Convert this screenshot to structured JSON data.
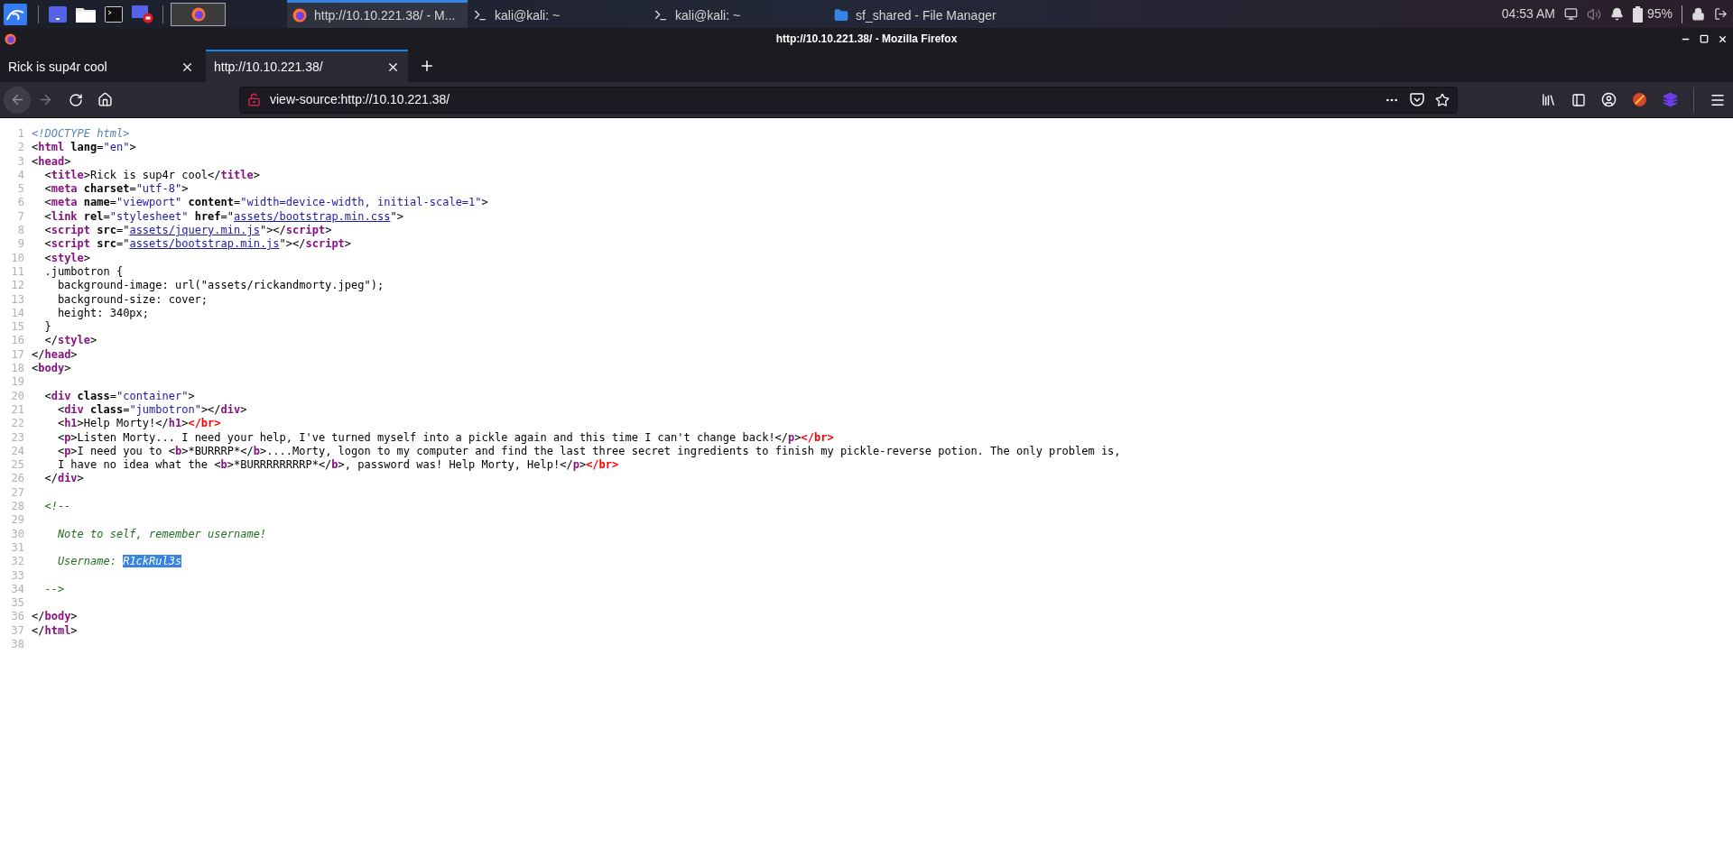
{
  "taskbar": {
    "windows": [
      {
        "kind": "browser",
        "title": "http://10.10.221.38/ - M...",
        "selected": true
      },
      {
        "kind": "terminal",
        "title": "kali@kali: ~",
        "selected": false
      },
      {
        "kind": "terminal",
        "title": "kali@kali: ~",
        "selected": false
      },
      {
        "kind": "folder",
        "title": "sf_shared - File Manager",
        "selected": false
      }
    ],
    "clock": "04:53 AM",
    "battery": "95%"
  },
  "window": {
    "title": "http://10.10.221.38/ - Mozilla Firefox"
  },
  "tabs": [
    {
      "label": "Rick is sup4r cool",
      "selected": false
    },
    {
      "label": "http://10.10.221.38/",
      "selected": true
    }
  ],
  "navigation": {
    "back_disabled": true,
    "forward_disabled": true
  },
  "address_bar": {
    "value": "view-source:http://10.10.221.38/"
  },
  "source": {
    "lines": [
      {
        "number": "1",
        "tokens": [
          {
            "kind": "doctype",
            "text": "<!DOCTYPE html>"
          }
        ]
      },
      {
        "number": "2",
        "tokens": [
          {
            "kind": "text",
            "text": "<"
          },
          {
            "kind": "tag",
            "text": "html"
          },
          {
            "kind": "attr",
            "text": " lang"
          },
          {
            "kind": "text",
            "text": "="
          },
          {
            "kind": "val",
            "text": "\"en\""
          },
          {
            "kind": "text",
            "text": ">"
          }
        ]
      },
      {
        "number": "3",
        "tokens": [
          {
            "kind": "text",
            "text": "<"
          },
          {
            "kind": "tag",
            "text": "head"
          },
          {
            "kind": "text",
            "text": ">"
          }
        ]
      },
      {
        "number": "4",
        "tokens": [
          {
            "kind": "text",
            "text": "  <"
          },
          {
            "kind": "tag",
            "text": "title"
          },
          {
            "kind": "text",
            "text": ">Rick is sup4r cool</"
          },
          {
            "kind": "tag",
            "text": "title"
          },
          {
            "kind": "text",
            "text": ">"
          }
        ]
      },
      {
        "number": "5",
        "tokens": [
          {
            "kind": "text",
            "text": "  <"
          },
          {
            "kind": "tag",
            "text": "meta"
          },
          {
            "kind": "attr",
            "text": " charset"
          },
          {
            "kind": "text",
            "text": "="
          },
          {
            "kind": "val",
            "text": "\"utf-8\""
          },
          {
            "kind": "text",
            "text": ">"
          }
        ]
      },
      {
        "number": "6",
        "tokens": [
          {
            "kind": "text",
            "text": "  <"
          },
          {
            "kind": "tag",
            "text": "meta"
          },
          {
            "kind": "attr",
            "text": " name"
          },
          {
            "kind": "text",
            "text": "="
          },
          {
            "kind": "val",
            "text": "\"viewport\""
          },
          {
            "kind": "attr",
            "text": " content"
          },
          {
            "kind": "text",
            "text": "="
          },
          {
            "kind": "val",
            "text": "\"width=device-width, initial-scale=1\""
          },
          {
            "kind": "text",
            "text": ">"
          }
        ]
      },
      {
        "number": "7",
        "tokens": [
          {
            "kind": "text",
            "text": "  <"
          },
          {
            "kind": "tag",
            "text": "link"
          },
          {
            "kind": "attr",
            "text": " rel"
          },
          {
            "kind": "text",
            "text": "="
          },
          {
            "kind": "val",
            "text": "\"stylesheet\""
          },
          {
            "kind": "attr",
            "text": " href"
          },
          {
            "kind": "text",
            "text": "=\""
          },
          {
            "kind": "link",
            "text": "assets/bootstrap.min.css"
          },
          {
            "kind": "text",
            "text": "\">"
          }
        ]
      },
      {
        "number": "8",
        "tokens": [
          {
            "kind": "text",
            "text": "  <"
          },
          {
            "kind": "tag",
            "text": "script"
          },
          {
            "kind": "attr",
            "text": " src"
          },
          {
            "kind": "text",
            "text": "=\""
          },
          {
            "kind": "link",
            "text": "assets/jquery.min.js"
          },
          {
            "kind": "text",
            "text": "\"></"
          },
          {
            "kind": "tag",
            "text": "script"
          },
          {
            "kind": "text",
            "text": ">"
          }
        ]
      },
      {
        "number": "9",
        "tokens": [
          {
            "kind": "text",
            "text": "  <"
          },
          {
            "kind": "tag",
            "text": "script"
          },
          {
            "kind": "attr",
            "text": " src"
          },
          {
            "kind": "text",
            "text": "=\""
          },
          {
            "kind": "link",
            "text": "assets/bootstrap.min.js"
          },
          {
            "kind": "text",
            "text": "\"></"
          },
          {
            "kind": "tag",
            "text": "script"
          },
          {
            "kind": "text",
            "text": ">"
          }
        ]
      },
      {
        "number": "10",
        "tokens": [
          {
            "kind": "text",
            "text": "  <"
          },
          {
            "kind": "tag",
            "text": "style"
          },
          {
            "kind": "text",
            "text": ">"
          }
        ]
      },
      {
        "number": "11",
        "tokens": [
          {
            "kind": "text",
            "text": "  .jumbotron {"
          }
        ]
      },
      {
        "number": "12",
        "tokens": [
          {
            "kind": "text",
            "text": "    background-image: url(\"assets/rickandmorty.jpeg\");"
          }
        ]
      },
      {
        "number": "13",
        "tokens": [
          {
            "kind": "text",
            "text": "    background-size: cover;"
          }
        ]
      },
      {
        "number": "14",
        "tokens": [
          {
            "kind": "text",
            "text": "    height: 340px;"
          }
        ]
      },
      {
        "number": "15",
        "tokens": [
          {
            "kind": "text",
            "text": "  }"
          }
        ]
      },
      {
        "number": "16",
        "tokens": [
          {
            "kind": "text",
            "text": "  </"
          },
          {
            "kind": "tag",
            "text": "style"
          },
          {
            "kind": "text",
            "text": ">"
          }
        ]
      },
      {
        "number": "17",
        "tokens": [
          {
            "kind": "text",
            "text": "</"
          },
          {
            "kind": "tag",
            "text": "head"
          },
          {
            "kind": "text",
            "text": ">"
          }
        ]
      },
      {
        "number": "18",
        "tokens": [
          {
            "kind": "text",
            "text": "<"
          },
          {
            "kind": "tag",
            "text": "body"
          },
          {
            "kind": "text",
            "text": ">"
          }
        ]
      },
      {
        "number": "19"
      },
      {
        "number": "20",
        "tokens": [
          {
            "kind": "text",
            "text": "  <"
          },
          {
            "kind": "tag",
            "text": "div"
          },
          {
            "kind": "attr",
            "text": " class"
          },
          {
            "kind": "text",
            "text": "="
          },
          {
            "kind": "val",
            "text": "\"container\""
          },
          {
            "kind": "text",
            "text": ">"
          }
        ]
      },
      {
        "number": "21",
        "tokens": [
          {
            "kind": "text",
            "text": "    <"
          },
          {
            "kind": "tag",
            "text": "div"
          },
          {
            "kind": "attr",
            "text": " class"
          },
          {
            "kind": "text",
            "text": "="
          },
          {
            "kind": "val",
            "text": "\"jumbotron\""
          },
          {
            "kind": "text",
            "text": "></"
          },
          {
            "kind": "tag",
            "text": "div"
          },
          {
            "kind": "text",
            "text": ">"
          }
        ]
      },
      {
        "number": "22",
        "tokens": [
          {
            "kind": "text",
            "text": "    <"
          },
          {
            "kind": "tag",
            "text": "h1"
          },
          {
            "kind": "text",
            "text": ">Help Morty!</"
          },
          {
            "kind": "tag",
            "text": "h1"
          },
          {
            "kind": "text",
            "text": ">"
          },
          {
            "kind": "err",
            "text": "</br>"
          }
        ]
      },
      {
        "number": "23",
        "tokens": [
          {
            "kind": "text",
            "text": "    <"
          },
          {
            "kind": "tag",
            "text": "p"
          },
          {
            "kind": "text",
            "text": ">Listen Morty... I need your help, I've turned myself into a pickle again and this time I can't change back!</"
          },
          {
            "kind": "tag",
            "text": "p"
          },
          {
            "kind": "text",
            "text": ">"
          },
          {
            "kind": "err",
            "text": "</br>"
          }
        ]
      },
      {
        "number": "24",
        "tokens": [
          {
            "kind": "text",
            "text": "    <"
          },
          {
            "kind": "tag",
            "text": "p"
          },
          {
            "kind": "text",
            "text": ">I need you to <"
          },
          {
            "kind": "tag",
            "text": "b"
          },
          {
            "kind": "text",
            "text": ">*BURRRP*</"
          },
          {
            "kind": "tag",
            "text": "b"
          },
          {
            "kind": "text",
            "text": ">....Morty, logon to my computer and find the last three secret ingredients to finish my pickle-reverse potion. The only problem is,"
          }
        ]
      },
      {
        "number": "25",
        "tokens": [
          {
            "kind": "text",
            "text": "    I have no idea what the <"
          },
          {
            "kind": "tag",
            "text": "b"
          },
          {
            "kind": "text",
            "text": ">*BURRRRRRRRP*</"
          },
          {
            "kind": "tag",
            "text": "b"
          },
          {
            "kind": "text",
            "text": ">, password was! Help Morty, Help!</"
          },
          {
            "kind": "tag",
            "text": "p"
          },
          {
            "kind": "text",
            "text": ">"
          },
          {
            "kind": "err",
            "text": "</br>"
          }
        ]
      },
      {
        "number": "26",
        "tokens": [
          {
            "kind": "text",
            "text": "  </"
          },
          {
            "kind": "tag",
            "text": "div"
          },
          {
            "kind": "text",
            "text": ">"
          }
        ]
      },
      {
        "number": "27"
      },
      {
        "number": "28",
        "tokens": [
          {
            "kind": "cmt",
            "text": "  <!--"
          }
        ]
      },
      {
        "number": "29"
      },
      {
        "number": "30",
        "tokens": [
          {
            "kind": "cmt",
            "text": "    Note to self, remember username!"
          }
        ]
      },
      {
        "number": "31"
      },
      {
        "number": "32",
        "tokens": [
          {
            "kind": "cmt",
            "text": "    Username: "
          },
          {
            "kind": "sel",
            "text": "R1ckRul3s"
          }
        ]
      },
      {
        "number": "33"
      },
      {
        "number": "34",
        "tokens": [
          {
            "kind": "cmt",
            "text": "  -->"
          }
        ]
      },
      {
        "number": "35"
      },
      {
        "number": "36",
        "tokens": [
          {
            "kind": "text",
            "text": "</"
          },
          {
            "kind": "tag",
            "text": "body"
          },
          {
            "kind": "text",
            "text": ">"
          }
        ]
      },
      {
        "number": "37",
        "tokens": [
          {
            "kind": "text",
            "text": "</"
          },
          {
            "kind": "tag",
            "text": "html"
          },
          {
            "kind": "text",
            "text": ">"
          }
        ]
      },
      {
        "number": "38"
      }
    ]
  }
}
